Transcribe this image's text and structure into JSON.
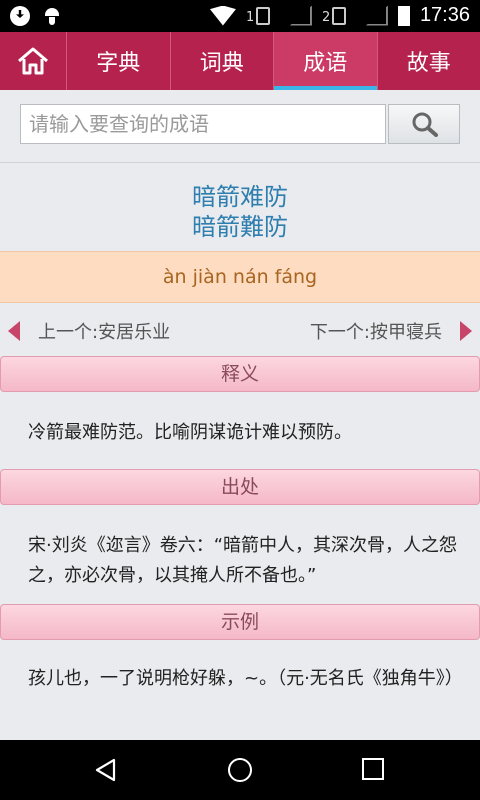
{
  "status_bar": {
    "sim1": "1",
    "sim2": "2",
    "time": "17:36"
  },
  "nav": {
    "tabs": [
      {
        "label": "字典"
      },
      {
        "label": "词典"
      },
      {
        "label": "成语"
      },
      {
        "label": "故事"
      }
    ],
    "active_tab": "成语"
  },
  "search": {
    "placeholder": "请输入要查询的成语"
  },
  "idiom": {
    "simplified": "暗箭难防",
    "traditional": "暗箭難防",
    "pinyin": "àn jiàn nán fáng"
  },
  "navigation": {
    "prev": "上一个:安居乐业",
    "next": "下一个:按甲寝兵"
  },
  "sections": {
    "meaning": {
      "title": "释义",
      "text": "冷箭最难防范。比喻阴谋诡计难以预防。"
    },
    "source": {
      "title": "出处",
      "text": "宋·刘炎《迩言》卷六：“暗箭中人，其深次骨，人之怨之，亦必次骨，以其掩人所不备也。”"
    },
    "example": {
      "title": "示例",
      "text": "孩儿也，一了说明枪好躲，~。（元·无名氏《独角牛》）"
    }
  },
  "colors": {
    "nav_bg": "#b6224e",
    "active_indicator": "#3bb4e8",
    "title_color": "#2e7fb0",
    "pinyin_bg": "#fddcc1",
    "section_bg": "#f5b8c8"
  }
}
